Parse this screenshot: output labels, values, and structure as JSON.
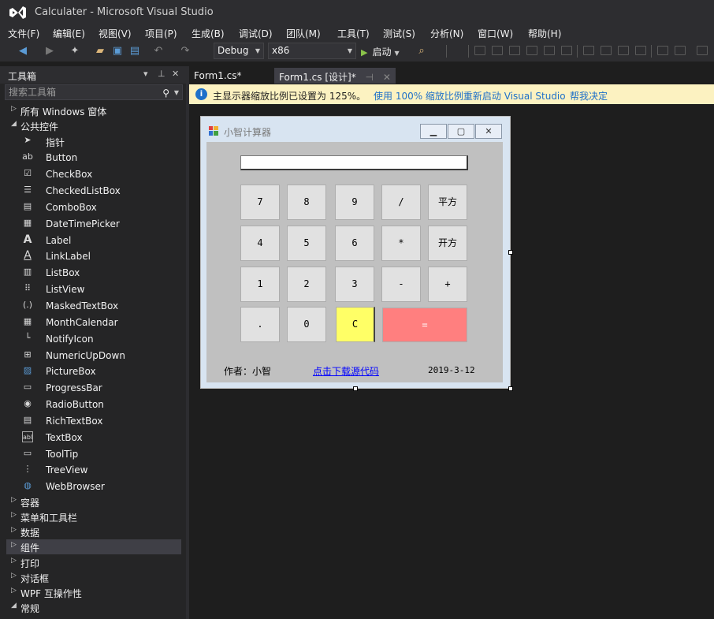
{
  "window": {
    "title": "Calculater - Microsoft Visual Studio"
  },
  "menu": [
    "文件(F)",
    "编辑(E)",
    "视图(V)",
    "项目(P)",
    "生成(B)",
    "调试(D)",
    "团队(M)",
    "工具(T)",
    "测试(S)",
    "分析(N)",
    "窗口(W)",
    "帮助(H)"
  ],
  "toolbar": {
    "config": "Debug",
    "platform": "x86",
    "start_label": "启动"
  },
  "toolbox": {
    "title": "工具箱",
    "search_placeholder": "搜索工具箱",
    "sections_top": [
      {
        "label": "所有 Windows 窗体",
        "expanded": false
      },
      {
        "label": "公共控件",
        "expanded": true
      }
    ],
    "items": [
      {
        "label": "指针",
        "icon": "pointer-icon"
      },
      {
        "label": "Button",
        "icon": "button-icon"
      },
      {
        "label": "CheckBox",
        "icon": "checkbox-icon"
      },
      {
        "label": "CheckedListBox",
        "icon": "checkedlistbox-icon"
      },
      {
        "label": "ComboBox",
        "icon": "combobox-icon"
      },
      {
        "label": "DateTimePicker",
        "icon": "datetimepicker-icon"
      },
      {
        "label": "Label",
        "icon": "label-icon"
      },
      {
        "label": "LinkLabel",
        "icon": "linklabel-icon"
      },
      {
        "label": "ListBox",
        "icon": "listbox-icon"
      },
      {
        "label": "ListView",
        "icon": "listview-icon"
      },
      {
        "label": "MaskedTextBox",
        "icon": "maskedtextbox-icon"
      },
      {
        "label": "MonthCalendar",
        "icon": "monthcalendar-icon"
      },
      {
        "label": "NotifyIcon",
        "icon": "notifyicon-icon"
      },
      {
        "label": "NumericUpDown",
        "icon": "numericupdown-icon"
      },
      {
        "label": "PictureBox",
        "icon": "picturebox-icon"
      },
      {
        "label": "ProgressBar",
        "icon": "progressbar-icon"
      },
      {
        "label": "RadioButton",
        "icon": "radiobutton-icon"
      },
      {
        "label": "RichTextBox",
        "icon": "richtextbox-icon"
      },
      {
        "label": "TextBox",
        "icon": "textbox-icon"
      },
      {
        "label": "ToolTip",
        "icon": "tooltip-icon"
      },
      {
        "label": "TreeView",
        "icon": "treeview-icon"
      },
      {
        "label": "WebBrowser",
        "icon": "webbrowser-icon"
      }
    ],
    "sections_bottom": [
      {
        "label": "容器",
        "expanded": false
      },
      {
        "label": "菜单和工具栏",
        "expanded": false
      },
      {
        "label": "数据",
        "expanded": false
      },
      {
        "label": "组件",
        "expanded": false,
        "selected": true
      },
      {
        "label": "打印",
        "expanded": false
      },
      {
        "label": "对话框",
        "expanded": false
      },
      {
        "label": "WPF 互操作性",
        "expanded": false
      },
      {
        "label": "常规",
        "expanded": true
      }
    ]
  },
  "tabs": [
    {
      "label": "Form1.cs*",
      "active": false
    },
    {
      "label": "Form1.cs [设计]*",
      "active": true
    }
  ],
  "infobar": {
    "message": "主显示器缩放比例已设置为 125%。",
    "link1": "使用 100% 缩放比例重新启动 Visual Studio",
    "link2": "帮我决定"
  },
  "form": {
    "title": "小智计算器",
    "display_value": "",
    "keys": [
      [
        "7",
        "8",
        "9",
        "/",
        "平方"
      ],
      [
        "4",
        "5",
        "6",
        "*",
        "开方"
      ],
      [
        "1",
        "2",
        "3",
        "-",
        "+"
      ],
      [
        ".",
        "0",
        "C",
        "="
      ]
    ],
    "author": "作者：小智",
    "download_link": "点击下载源代码",
    "date": "2019-3-12"
  },
  "colors": {
    "clear_key": "#ffff66",
    "equals_key": "#ff7f7f",
    "accent": "#1e70c9"
  }
}
